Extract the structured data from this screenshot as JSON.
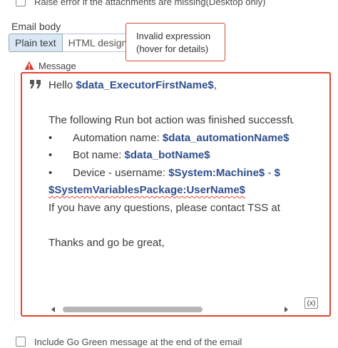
{
  "top_option": {
    "label": "Raise error if the attachments are missing(Desktop only)"
  },
  "email_body": {
    "label": "Email body",
    "tabs": [
      {
        "label": "Plain text",
        "active": true
      },
      {
        "label": "HTML designer",
        "active": false
      }
    ]
  },
  "tooltip": {
    "line1": "Invalid expression",
    "line2": "(hover for details)"
  },
  "message": {
    "label": "Message",
    "lines": {
      "l1_text": "Hello ",
      "l1_var": "$data_ExecutorFirstName$",
      "l1_tail": ",",
      "l3_text": "The following Run bot action was finished successfully",
      "b1_text": "Automation name: ",
      "b1_var": "$data_automationName$",
      "b2_text": "Bot name: ",
      "b2_var": "$data_botName$",
      "b3_text": "Device - username: ",
      "b3_var1": "$System:Machine$",
      "b3_sep": " - ",
      "b3_var2": "$",
      "l7_var": "$SystemVariablesPackage:UserName$",
      "l8_text": "If you have any questions, please contact TSS at",
      "l10_text": "Thanks and go be great,"
    },
    "bullet_char": "•",
    "fx_label": "(x)"
  },
  "bottom_option": {
    "label": "Include Go Green message at the end of the email"
  },
  "colors": {
    "error": "#e0452f",
    "variable": "#2e4f8c",
    "tab_active_bg": "#dbe7f2"
  }
}
